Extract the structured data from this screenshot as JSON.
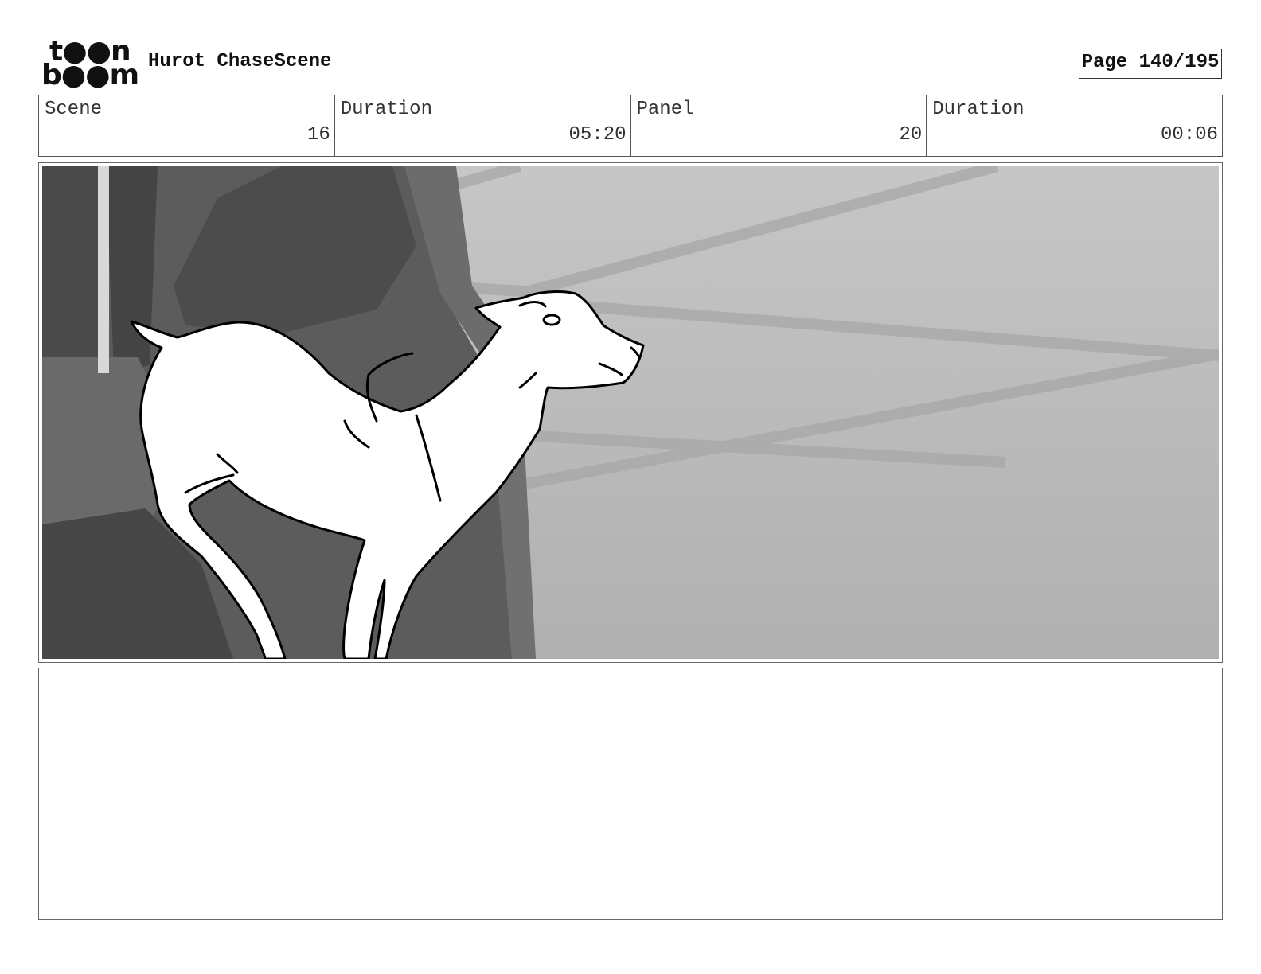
{
  "header": {
    "logo": {
      "line1": "t●●n",
      "line2": "b●●m",
      "text": "toon boom"
    },
    "title": "Hurot ChaseScene",
    "page_label": "Page 140/195"
  },
  "info": {
    "scene_label": "Scene",
    "scene_value": "16",
    "scene_duration_label": "Duration",
    "scene_duration_value": "05:20",
    "panel_label": "Panel",
    "panel_value": "20",
    "panel_duration_label": "Duration",
    "panel_duration_value": "00:06"
  },
  "panel_image": {
    "subject": "deer-sketch",
    "colors": {
      "sky": "#bdbdbd",
      "rock": "#5a5a5a",
      "dark": "#3f3f3f",
      "deer": "#ffffff",
      "line": "#000000"
    }
  },
  "notes": {
    "text": ""
  }
}
